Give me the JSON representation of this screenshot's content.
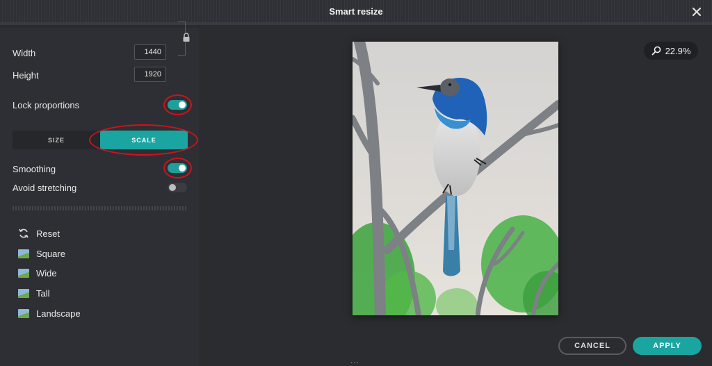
{
  "window": {
    "title": "Smart resize"
  },
  "dimensions": {
    "width_label": "Width",
    "width_value": "1440",
    "height_label": "Height",
    "height_value": "1920"
  },
  "toggles": {
    "lock_label": "Lock proportions",
    "lock_on": true,
    "smoothing_label": "Smoothing",
    "smoothing_on": true,
    "avoid_label": "Avoid stretching",
    "avoid_on": false
  },
  "mode": {
    "size_label": "SIZE",
    "scale_label": "SCALE",
    "active": "SCALE"
  },
  "presets": [
    {
      "label": "Reset",
      "icon": "reset-icon"
    },
    {
      "label": "Square",
      "icon": "image-icon"
    },
    {
      "label": "Wide",
      "icon": "image-icon"
    },
    {
      "label": "Tall",
      "icon": "image-icon"
    },
    {
      "label": "Landscape",
      "icon": "image-icon"
    }
  ],
  "zoom": {
    "value": "22.9%"
  },
  "footer": {
    "cancel_label": "CANCEL",
    "apply_label": "APPLY",
    "more": "..."
  },
  "colors": {
    "accent": "#1aa5a1",
    "annotation": "#d0121b",
    "background": "#2a2b2f"
  }
}
